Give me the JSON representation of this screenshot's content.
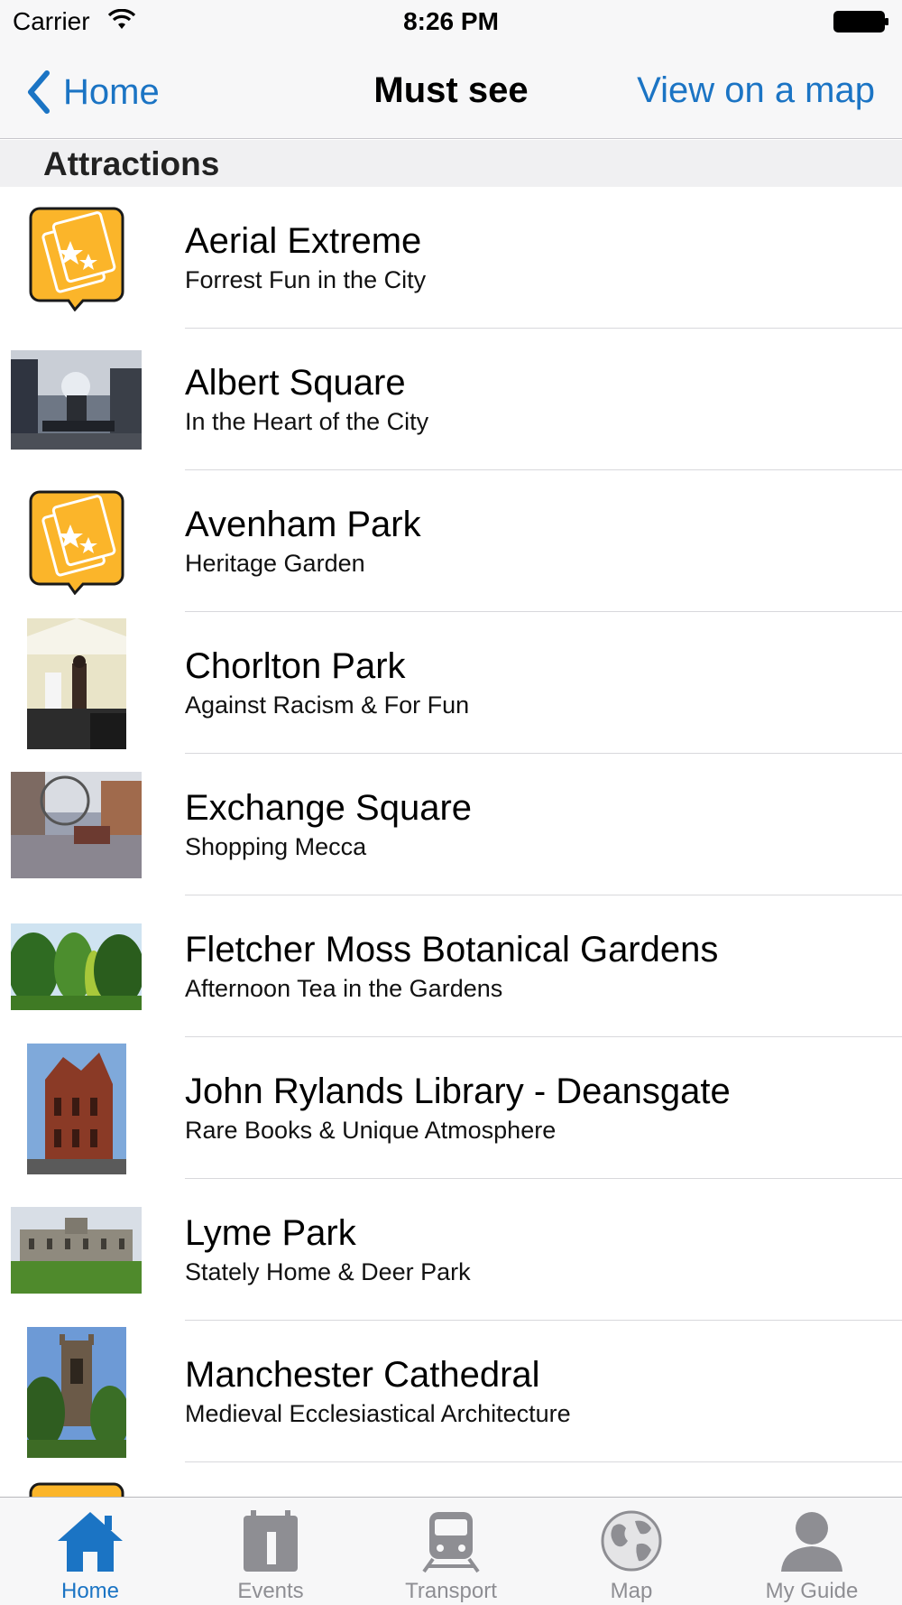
{
  "status_bar": {
    "carrier": "Carrier",
    "time": "8:26 PM"
  },
  "nav": {
    "back_label": "Home",
    "title": "Must see",
    "map_label": "View on a map"
  },
  "section": {
    "title": "Attractions"
  },
  "rows": [
    {
      "title": "Aerial Extreme",
      "subtitle": "Forrest Fun in the City",
      "thumb": "ticket-icon"
    },
    {
      "title": "Albert Square",
      "subtitle": "In the Heart of the City",
      "thumb": "fountain-photo"
    },
    {
      "title": "Avenham Park",
      "subtitle": "Heritage Garden",
      "thumb": "ticket-icon"
    },
    {
      "title": "Chorlton Park",
      "subtitle": "Against Racism & For Fun",
      "thumb": "concert-photo"
    },
    {
      "title": "Exchange Square",
      "subtitle": "Shopping Mecca",
      "thumb": "square-photo"
    },
    {
      "title": "Fletcher Moss Botanical Gardens",
      "subtitle": "Afternoon Tea in the Gardens",
      "thumb": "garden-photo"
    },
    {
      "title": "John Rylands Library - Deansgate",
      "subtitle": "Rare Books & Unique Atmosphere",
      "thumb": "library-photo"
    },
    {
      "title": "Lyme Park",
      "subtitle": "Stately Home & Deer Park",
      "thumb": "manor-photo"
    },
    {
      "title": "Manchester Cathedral",
      "subtitle": "Medieval Ecclesiastical Architecture",
      "thumb": "cathedral-photo"
    }
  ],
  "tabs": [
    {
      "label": "Home",
      "icon": "home-icon",
      "active": true
    },
    {
      "label": "Events",
      "icon": "calendar-icon",
      "active": false
    },
    {
      "label": "Transport",
      "icon": "train-icon",
      "active": false
    },
    {
      "label": "Map",
      "icon": "globe-icon",
      "active": false
    },
    {
      "label": "My Guide",
      "icon": "person-icon",
      "active": false
    }
  ],
  "colors": {
    "accent": "#1b74c4",
    "ticket": "#fbb52a",
    "inactive": "#8e8e93"
  }
}
